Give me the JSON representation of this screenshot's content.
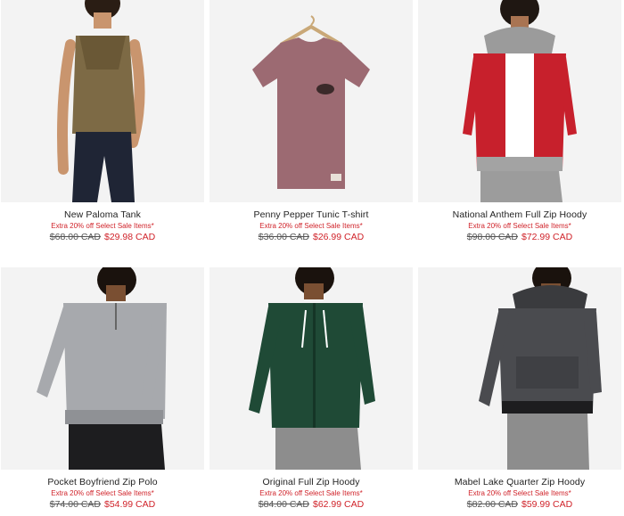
{
  "products": [
    {
      "name": "New Paloma Tank",
      "promo": "Extra 20% off Select Sale Items*",
      "was_price": "$68.00 CAD",
      "now_price": "$29.98 CAD",
      "image_icon": "model-olive-tank-photo"
    },
    {
      "name": "Penny Pepper Tunic T-shirt",
      "promo": "Extra 20% off Select Sale Items*",
      "was_price": "$36.00 CAD",
      "now_price": "$26.99 CAD",
      "image_icon": "hanger-tshirt-photo"
    },
    {
      "name": "National Anthem Full Zip Hoody",
      "promo": "Extra 20% off Select Sale Items*",
      "was_price": "$98.00 CAD",
      "now_price": "$72.99 CAD",
      "image_icon": "model-red-hoody-photo"
    },
    {
      "name": "Pocket Boyfriend Zip Polo",
      "promo": "Extra 20% off Select Sale Items*",
      "was_price": "$74.00 CAD",
      "now_price": "$54.99 CAD",
      "image_icon": "model-grey-polo-photo"
    },
    {
      "name": "Original Full Zip Hoody",
      "promo": "Extra 20% off Select Sale Items*",
      "was_price": "$84.00 CAD",
      "now_price": "$62.99 CAD",
      "image_icon": "model-green-hoody-photo"
    },
    {
      "name": "Mabel Lake Quarter Zip Hoody",
      "promo": "Extra 20% off Select Sale Items*",
      "was_price": "$82.00 CAD",
      "now_price": "$59.99 CAD",
      "image_icon": "model-charcoal-hoody-photo"
    }
  ],
  "colors": {
    "sale_red": "#d0232a",
    "tile_bg": "#f2f2f2"
  }
}
